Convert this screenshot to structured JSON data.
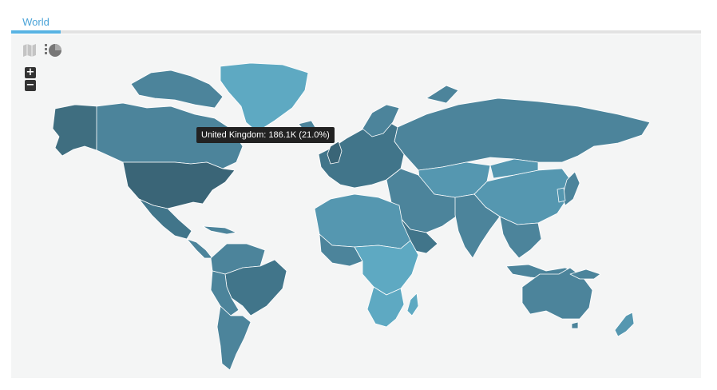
{
  "tabs": [
    {
      "label": "World",
      "active": true
    }
  ],
  "toolbar": {
    "map_view_icon": "map-icon",
    "chart_view_icon": "pie-chart-icon",
    "zoom_in_label": "+",
    "zoom_out_label": "−"
  },
  "tooltip": {
    "text": "United Kingdom: 186.1K (21.0%)"
  },
  "colors": {
    "tab_accent": "#58b3e3",
    "tooltip_bg": "#222222",
    "shade_darkest": "#3a6577",
    "shade_dark": "#41758a",
    "shade_mid": "#4c849b",
    "shade_light": "#5597b0",
    "shade_lightest": "#5ea9c2"
  }
}
